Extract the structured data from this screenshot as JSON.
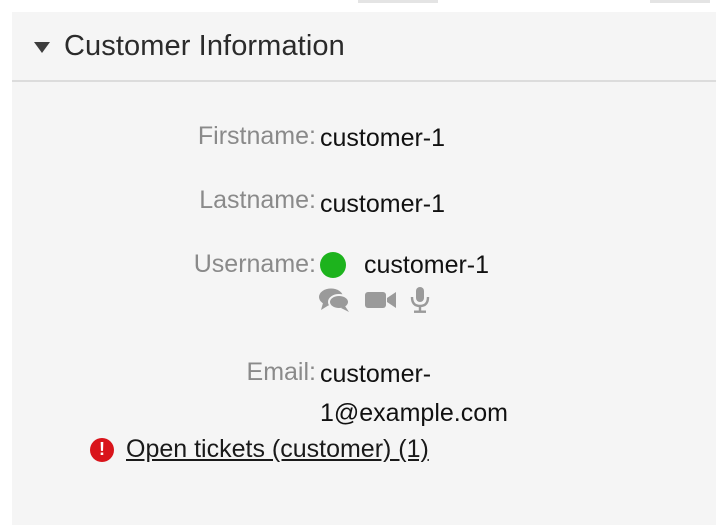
{
  "widget": {
    "title": "Customer Information"
  },
  "fields": {
    "firstname": {
      "label": "Firstname:",
      "value": "customer-1"
    },
    "lastname": {
      "label": "Lastname:",
      "value": "customer-1"
    },
    "username": {
      "label": "Username:",
      "value": "customer-1",
      "status_color": "#1db31d"
    },
    "email": {
      "label": "Email:",
      "value_line1": "customer-",
      "value_line2": "1@example.com"
    }
  },
  "contact_icons": [
    "chat-icon",
    "video-icon",
    "microphone-icon"
  ],
  "tickets": {
    "alert_symbol": "!",
    "link_label": "Open tickets (customer) (1)"
  }
}
